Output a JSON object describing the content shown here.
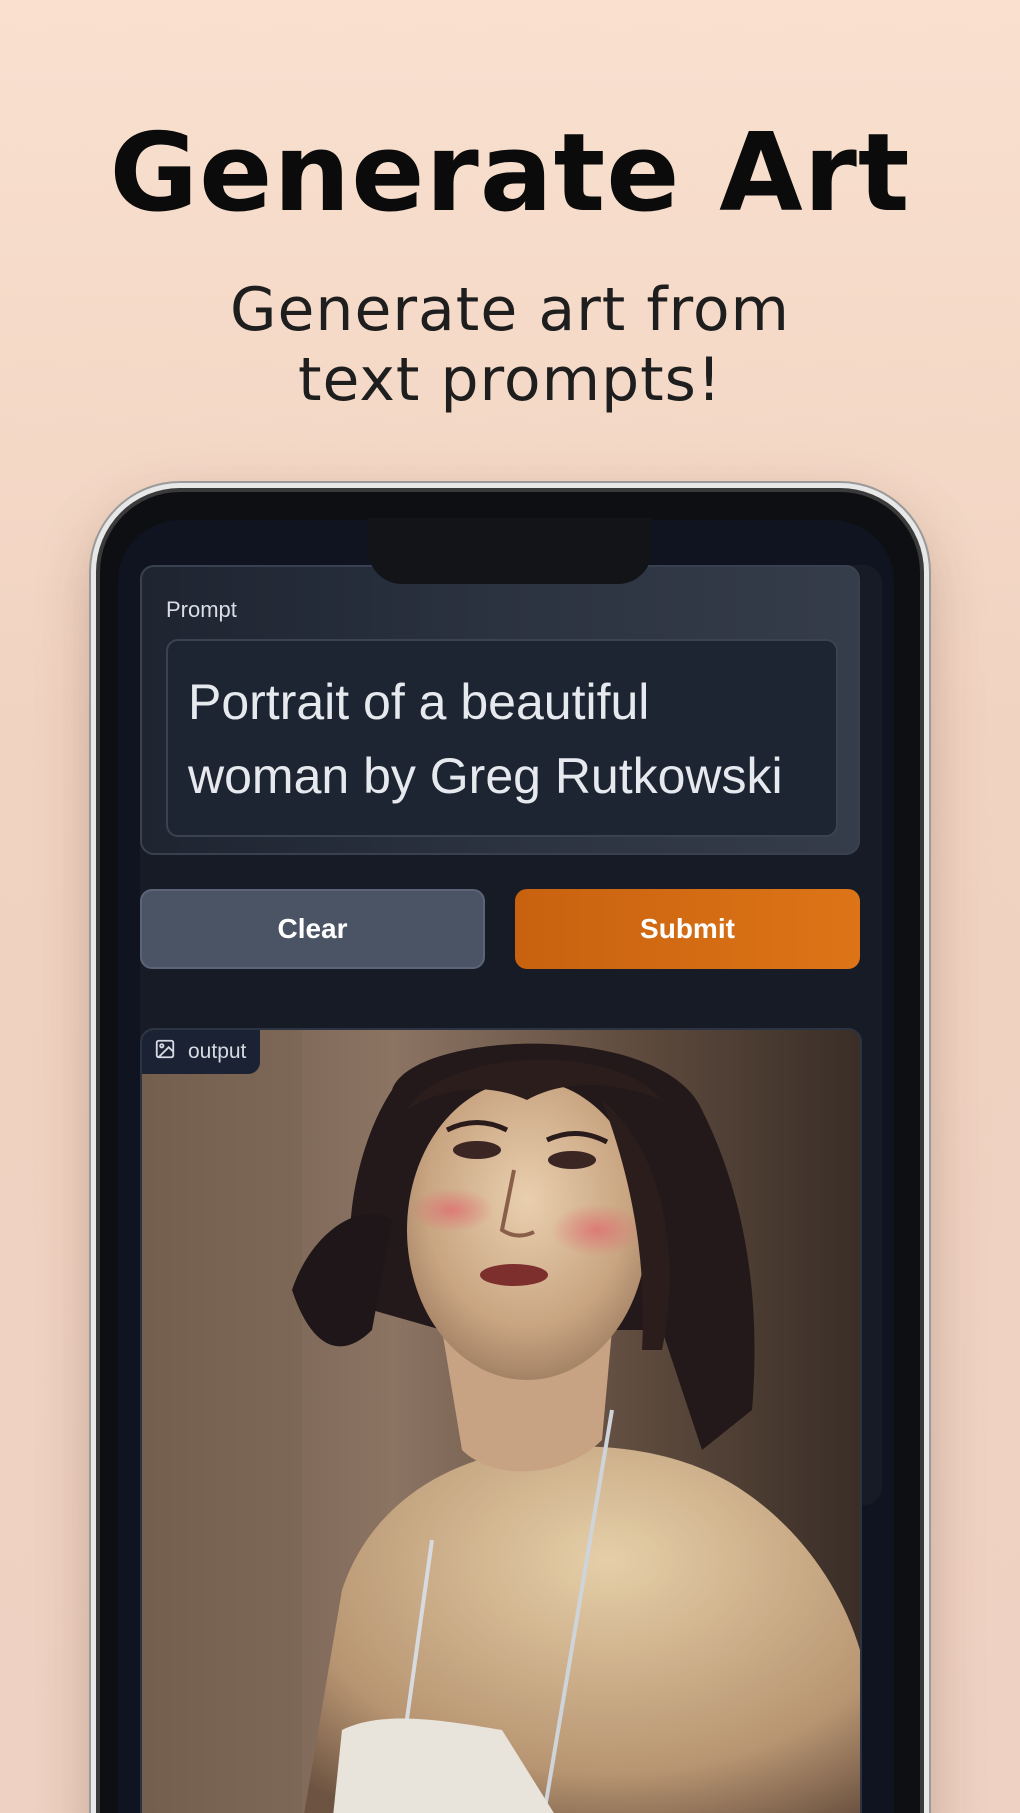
{
  "promo": {
    "headline": "Generate Art",
    "subline_1": "Generate art from",
    "subline_2": "text prompts!"
  },
  "app": {
    "prompt_label": "Prompt",
    "prompt_line_1": "Portrait of a beautiful",
    "prompt_line_2": "woman by Greg Rutkowski",
    "clear_label": "Clear",
    "submit_label": "Submit",
    "output_label": "output",
    "output_icon": "image-icon"
  },
  "colors": {
    "accent": "#d96f14",
    "panel": "#161b26",
    "background": "#f6dccb"
  }
}
